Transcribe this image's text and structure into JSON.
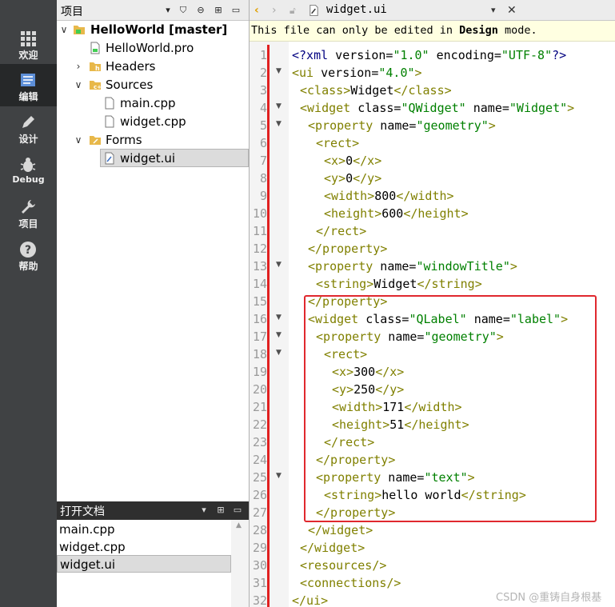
{
  "modes": [
    {
      "label": "欢迎",
      "icon": "grid-icon"
    },
    {
      "label": "编辑",
      "icon": "document-icon",
      "active": true
    },
    {
      "label": "设计",
      "icon": "pencil-icon"
    },
    {
      "label": "Debug",
      "icon": "bug-icon"
    },
    {
      "label": "项目",
      "icon": "wrench-icon"
    },
    {
      "label": "帮助",
      "icon": "help-icon"
    }
  ],
  "project_panel": {
    "title": "项目",
    "tree": [
      {
        "label": "HelloWorld [master]",
        "bold": true
      },
      {
        "label": "HelloWorld.pro"
      },
      {
        "label": "Headers"
      },
      {
        "label": "Sources"
      },
      {
        "label": "main.cpp"
      },
      {
        "label": "widget.cpp"
      },
      {
        "label": "Forms"
      },
      {
        "label": "widget.ui",
        "selected": true
      }
    ]
  },
  "open_documents": {
    "title": "打开文档",
    "items": [
      "main.cpp",
      "widget.cpp",
      "widget.ui"
    ],
    "selected": "widget.ui"
  },
  "editor": {
    "file_name": "widget.ui",
    "info_prefix": "This file can only be edited in ",
    "info_bold": "Design",
    "info_suffix": " mode.",
    "line_numbers": [
      "1",
      "2",
      "3",
      "4",
      "5",
      "6",
      "7",
      "8",
      "9",
      "10",
      "11",
      "12",
      "13",
      "14",
      "15",
      "16",
      "17",
      "18",
      "19",
      "20",
      "21",
      "22",
      "23",
      "24",
      "25",
      "26",
      "27",
      "28",
      "29",
      "30",
      "31",
      "32"
    ],
    "lines": [
      "<?xml version=\"1.0\" encoding=\"UTF-8\"?>",
      "<ui version=\"4.0\">",
      " <class>Widget</class>",
      " <widget class=\"QWidget\" name=\"Widget\">",
      "  <property name=\"geometry\">",
      "   <rect>",
      "    <x>0</x>",
      "    <y>0</y>",
      "    <width>800</width>",
      "    <height>600</height>",
      "   </rect>",
      "  </property>",
      "  <property name=\"windowTitle\">",
      "   <string>Widget</string>",
      "  </property>",
      "  <widget class=\"QLabel\" name=\"label\">",
      "   <property name=\"geometry\">",
      "    <rect>",
      "     <x>300</x>",
      "     <y>250</y>",
      "     <width>171</width>",
      "     <height>51</height>",
      "    </rect>",
      "   </property>",
      "   <property name=\"text\">",
      "    <string>hello world</string>",
      "   </property>",
      "  </widget>",
      " </widget>",
      " <resources/>",
      " <connections/>",
      "</ui>"
    ],
    "fold_lines": [
      2,
      4,
      5,
      13,
      16,
      17,
      18,
      25
    ]
  },
  "watermark": "CSDN @重铸自身根基",
  "colors": {
    "highlight_box": "#e0282e",
    "change_bar": "#e02020",
    "mode_bar": "#404244"
  }
}
